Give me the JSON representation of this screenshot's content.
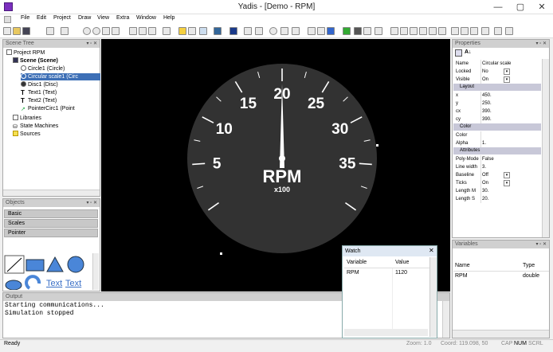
{
  "window": {
    "title": "Yadis - [Demo - RPM]",
    "minimize": "—",
    "restore": "▢",
    "close": "✕"
  },
  "menu": [
    "File",
    "Edit",
    "Project",
    "Draw",
    "View",
    "Extra",
    "Window",
    "Help"
  ],
  "scene_tree": {
    "title": "Scene Tree",
    "items": [
      "Project RPM",
      "Scene (Scene)",
      "Circle1 (Circle)",
      "Circular scale1 (Circ",
      "Disc1 (Disc)",
      "Text1 (Text)",
      "Text2 (Text)",
      "PointerCirc1 (Point",
      "Libraries",
      "State Machines",
      "Sources"
    ]
  },
  "objects": {
    "title": "Objects",
    "categories": [
      "Basic",
      "Scales",
      "Pointer"
    ],
    "shape_labels": [
      "Text",
      "Text"
    ]
  },
  "gauge": {
    "ticks": [
      "5",
      "10",
      "15",
      "20",
      "25",
      "30",
      "35"
    ],
    "label": "RPM",
    "multiplier": "x100",
    "needle_value": 20
  },
  "properties": {
    "title": "Properties",
    "rows": [
      {
        "name": "Name",
        "value": "Circular scale"
      },
      {
        "name": "Locked",
        "value": "No"
      },
      {
        "name": "Visible",
        "value": "On"
      }
    ],
    "layout_title": "Layout",
    "layout": [
      {
        "name": "x",
        "value": "450."
      },
      {
        "name": "y",
        "value": "250."
      },
      {
        "name": "cx",
        "value": "390."
      },
      {
        "name": "cy",
        "value": "390."
      }
    ],
    "color_title": "Color",
    "color": [
      {
        "name": "Color",
        "value": ""
      },
      {
        "name": "Alpha",
        "value": "1."
      }
    ],
    "attr_title": "Attributes",
    "attributes": [
      {
        "name": "Poly-Mode",
        "value": "False"
      },
      {
        "name": "Line width",
        "value": "3."
      },
      {
        "name": "Baseline",
        "value": "Off"
      },
      {
        "name": "Ticks",
        "value": "On"
      },
      {
        "name": "Length M",
        "value": "30."
      },
      {
        "name": "Length S",
        "value": "20."
      }
    ]
  },
  "watch": {
    "title": "Watch",
    "col_variable": "Variable",
    "col_value": "Value",
    "rows": [
      {
        "variable": "RPM",
        "value": "1120"
      }
    ]
  },
  "variables": {
    "title": "Variables",
    "col_name": "Name",
    "col_type": "Type",
    "rows": [
      {
        "name": "RPM",
        "type": "double"
      }
    ]
  },
  "output": {
    "title": "Output",
    "lines": [
      "Starting communications...",
      "Simulation stopped"
    ]
  },
  "status": {
    "left": "Ready",
    "zoom": "Zoom: 1.0",
    "coord": "Coord: 119.098, 50",
    "caps": "CAP",
    "num": "NUM",
    "scrl": "SCRL"
  },
  "colors": {
    "selection": "#3d6fb6",
    "canvas": "#000000",
    "gauge_face": "#333333"
  }
}
